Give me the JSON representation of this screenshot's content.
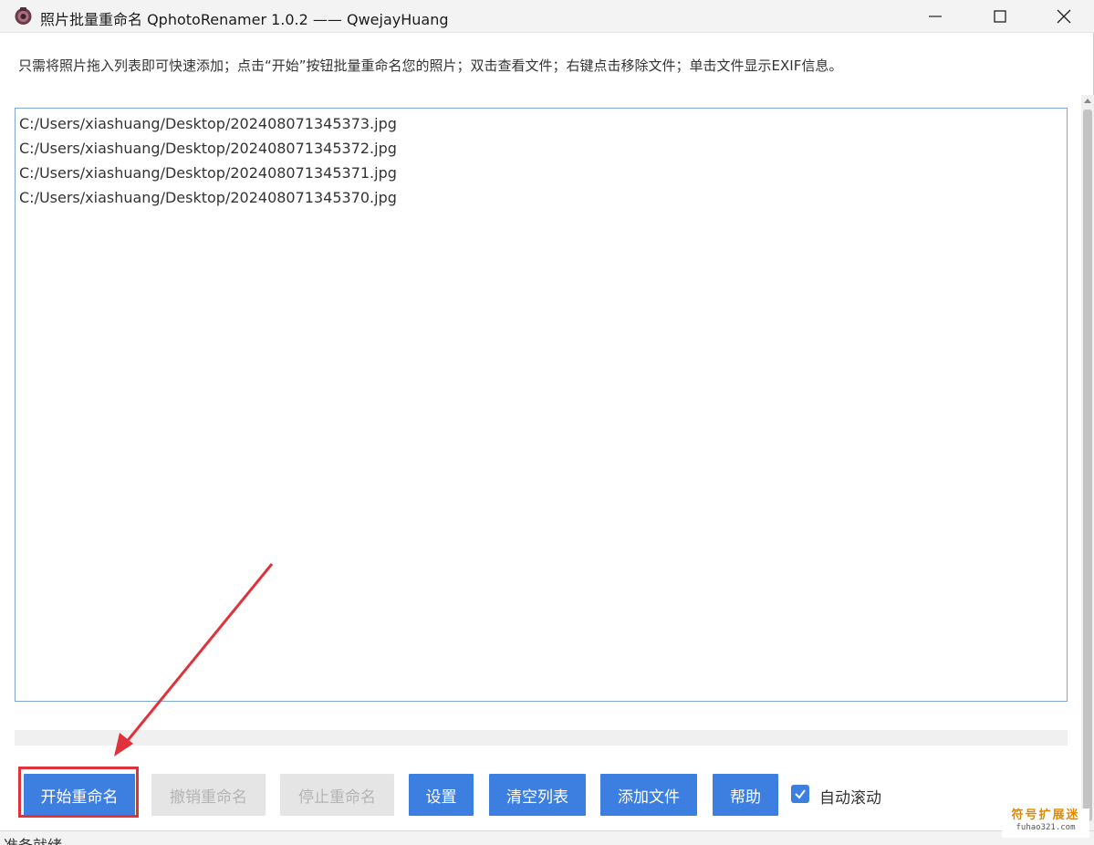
{
  "window": {
    "title": "照片批量重命名 QphotoRenamer 1.0.2 —— QwejayHuang"
  },
  "instruction": "只需将照片拖入列表即可快速添加；点击“开始”按钮批量重命名您的照片；双击查看文件；右键点击移除文件；单击文件显示EXIF信息。",
  "file_list": [
    "C:/Users/xiashuang/Desktop/202408071345373.jpg",
    "C:/Users/xiashuang/Desktop/202408071345372.jpg",
    "C:/Users/xiashuang/Desktop/202408071345371.jpg",
    "C:/Users/xiashuang/Desktop/202408071345370.jpg"
  ],
  "progress": {
    "value": 0
  },
  "buttons": {
    "start": "开始重命名",
    "undo": "撤销重命名",
    "stop": "停止重命名",
    "settings": "设置",
    "clear": "清空列表",
    "add": "添加文件",
    "help": "帮助"
  },
  "auto_scroll": {
    "label": "自动滚动",
    "checked": true
  },
  "status": "准备就绪",
  "watermark": {
    "main": "符号扩展迷",
    "sub": "fuhao321.com"
  },
  "colors": {
    "accent": "#3d7fe0",
    "highlight": "#e0323a"
  }
}
